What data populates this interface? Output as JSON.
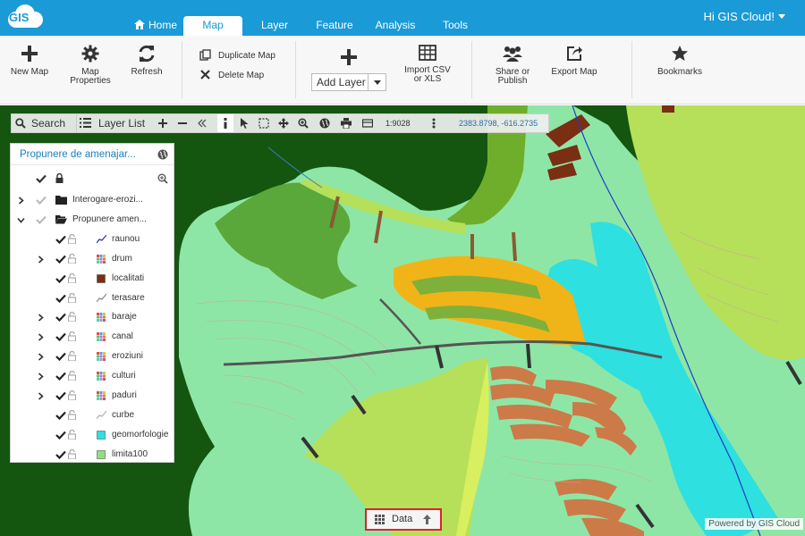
{
  "app": {
    "logo_text": "GIS",
    "brand_color": "#1a9ad6"
  },
  "nav": {
    "tabs": [
      {
        "label": "Home",
        "icon": "home-icon"
      },
      {
        "label": "Map",
        "active": true
      },
      {
        "label": "Layer"
      },
      {
        "label": "Feature"
      },
      {
        "label": "Analysis"
      },
      {
        "label": "Tools"
      }
    ],
    "user": "Hi GIS Cloud!"
  },
  "ribbon": {
    "new_map": "New Map",
    "map_properties_1": "Map",
    "map_properties_2": "Properties",
    "refresh": "Refresh",
    "duplicate_map": "Duplicate Map",
    "delete_map": "Delete Map",
    "add_layer": "Add Layer",
    "import_1": "Import CSV",
    "import_2": "or XLS",
    "share_1": "Share or",
    "share_2": "Publish",
    "export_map": "Export Map",
    "bookmarks": "Bookmarks"
  },
  "map_toolbar": {
    "search": "Search",
    "layer_list": "Layer List",
    "scale": "1:9028",
    "coordinates": "2383.8798, -616.2735"
  },
  "layer_panel": {
    "title": "Propunere de amenajar...",
    "rows": [
      {
        "label": "Interogare-erozi...",
        "type": "folder"
      },
      {
        "label": "Propunere amen...",
        "type": "folder-open"
      },
      {
        "label": "raunou",
        "symbol": "line",
        "color": "#2233aa"
      },
      {
        "label": "drum",
        "symbol": "grid",
        "expandable": true
      },
      {
        "label": "localitati",
        "symbol": "square",
        "color": "#7a2e12"
      },
      {
        "label": "terasare",
        "symbol": "line",
        "color": "#888888"
      },
      {
        "label": "baraje",
        "symbol": "grid",
        "expandable": true
      },
      {
        "label": "canal",
        "symbol": "grid",
        "expandable": true
      },
      {
        "label": "eroziuni",
        "symbol": "grid",
        "expandable": true
      },
      {
        "label": "culturi",
        "symbol": "grid",
        "expandable": true
      },
      {
        "label": "paduri",
        "symbol": "grid",
        "expandable": true
      },
      {
        "label": "curbe",
        "symbol": "line",
        "color": "#b0b0b0"
      },
      {
        "label": "geomorfologie",
        "symbol": "square",
        "color": "#2ee0e0"
      },
      {
        "label": "limita100",
        "symbol": "square",
        "color": "#8ee07e"
      }
    ]
  },
  "bottom": {
    "data_button": "Data",
    "powered_by": "Powered by GIS Cloud"
  },
  "colors": {
    "dark_forest": "#14560f",
    "light_green": "#8ee6a6",
    "lime": "#b6e05a",
    "cyan": "#2ee0e0",
    "orange": "#f0b418",
    "terrace_brown": "#cc7a48",
    "settlement": "#7a2e12",
    "highlight_red": "#e0202c"
  }
}
